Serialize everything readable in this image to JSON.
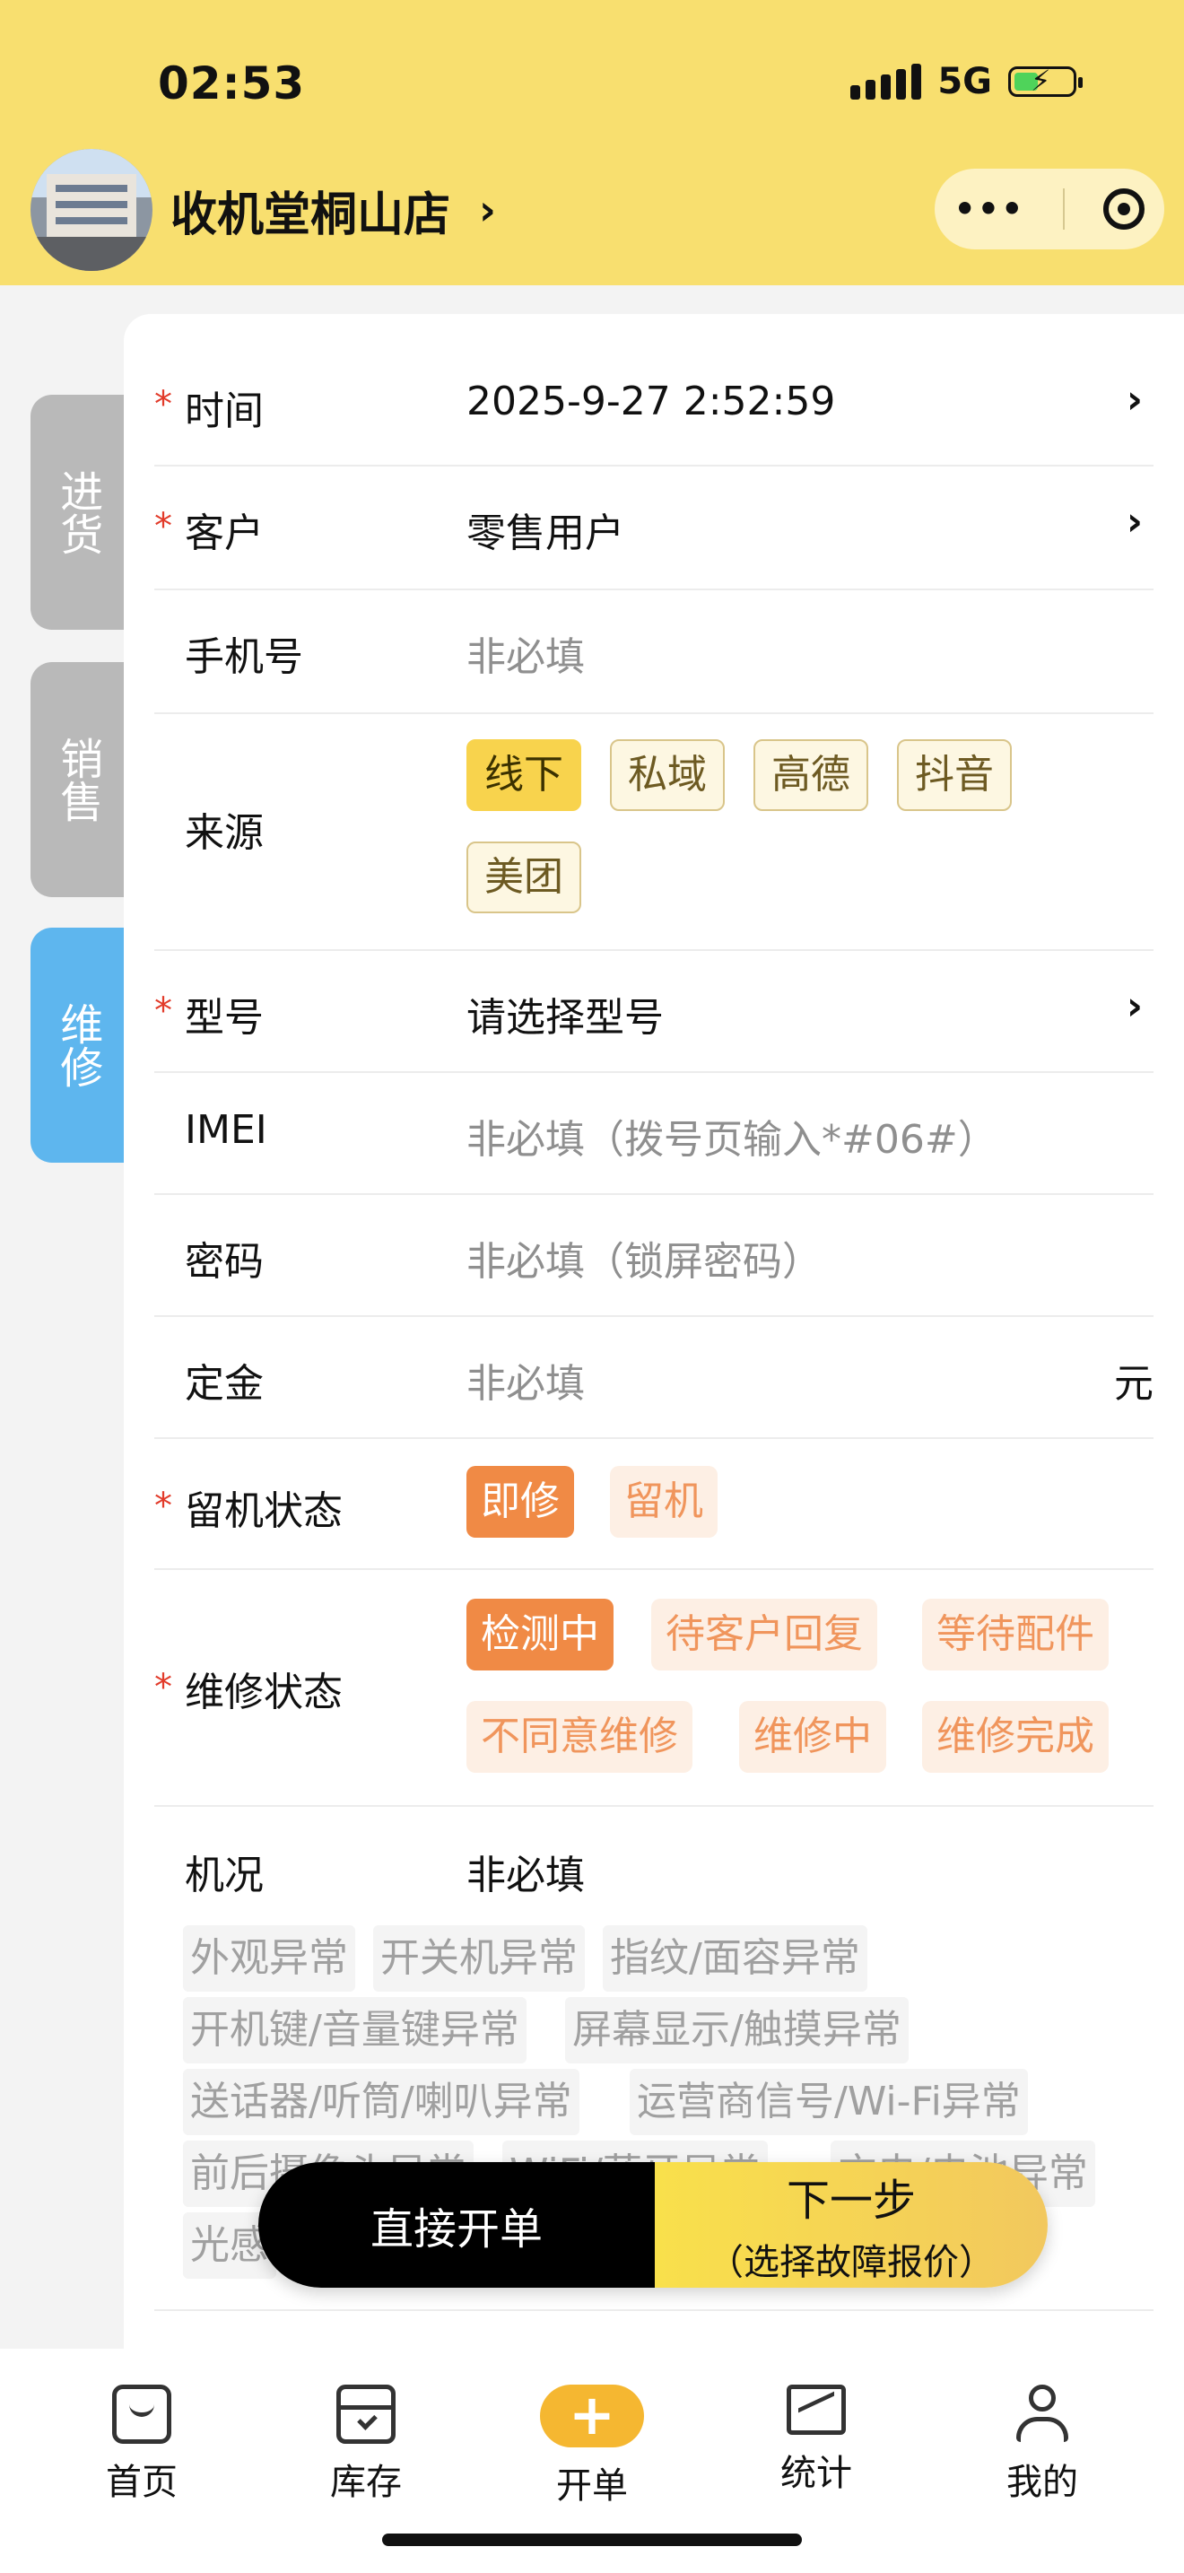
{
  "status_bar": {
    "time": "02:53",
    "network": "5G"
  },
  "header": {
    "store_name": "收机堂桐山店",
    "chevron": "›",
    "more": "•••"
  },
  "side_tabs": [
    {
      "label": "进货",
      "active": false
    },
    {
      "label": "销售",
      "active": false
    },
    {
      "label": "维修",
      "active": true
    }
  ],
  "form": {
    "required_mark": "*",
    "time": {
      "label": "时间",
      "value": "2025-9-27 2:52:59"
    },
    "customer": {
      "label": "客户",
      "value": "零售用户"
    },
    "phone": {
      "label": "手机号",
      "placeholder": "非必填"
    },
    "source": {
      "label": "来源",
      "options": [
        "线下",
        "私域",
        "高德",
        "抖音",
        "美团"
      ],
      "selected": "线下"
    },
    "model": {
      "label": "型号",
      "placeholder": "请选择型号"
    },
    "imei": {
      "label": "IMEI",
      "placeholder": "非必填（拨号页输入*#06#）"
    },
    "password": {
      "label": "密码",
      "placeholder": "非必填（锁屏密码）"
    },
    "deposit": {
      "label": "定金",
      "placeholder": "非必填",
      "unit": "元"
    },
    "retain_status": {
      "label": "留机状态",
      "options": [
        "即修",
        "留机"
      ],
      "selected": "即修"
    },
    "repair_status": {
      "label": "维修状态",
      "options": [
        "检测中",
        "待客户回复",
        "等待配件",
        "不同意维修",
        "维修中",
        "维修完成"
      ],
      "selected": "检测中"
    },
    "condition": {
      "label": "机况",
      "placeholder": "非必填",
      "tags": [
        "外观异常",
        "开关机异常",
        "指纹/面容异常",
        "开机键/音量键异常",
        "屏幕显示/触摸异常",
        "送话器/听筒/喇叭异常",
        "运营商信号/Wi-Fi异常",
        "前后摄像头异常",
        "WiFi/蓝牙异常",
        "充电/电池异常",
        "光感"
      ]
    }
  },
  "actions": {
    "direct": "直接开单",
    "next": "下一步",
    "next_sub": "（选择故障报价）"
  },
  "bottom_nav": [
    {
      "label": "首页",
      "icon": "home-bag-icon"
    },
    {
      "label": "库存",
      "icon": "inventory-box-icon"
    },
    {
      "label": "开单",
      "icon": "plus-icon"
    },
    {
      "label": "统计",
      "icon": "chart-icon"
    },
    {
      "label": "我的",
      "icon": "user-icon"
    }
  ]
}
